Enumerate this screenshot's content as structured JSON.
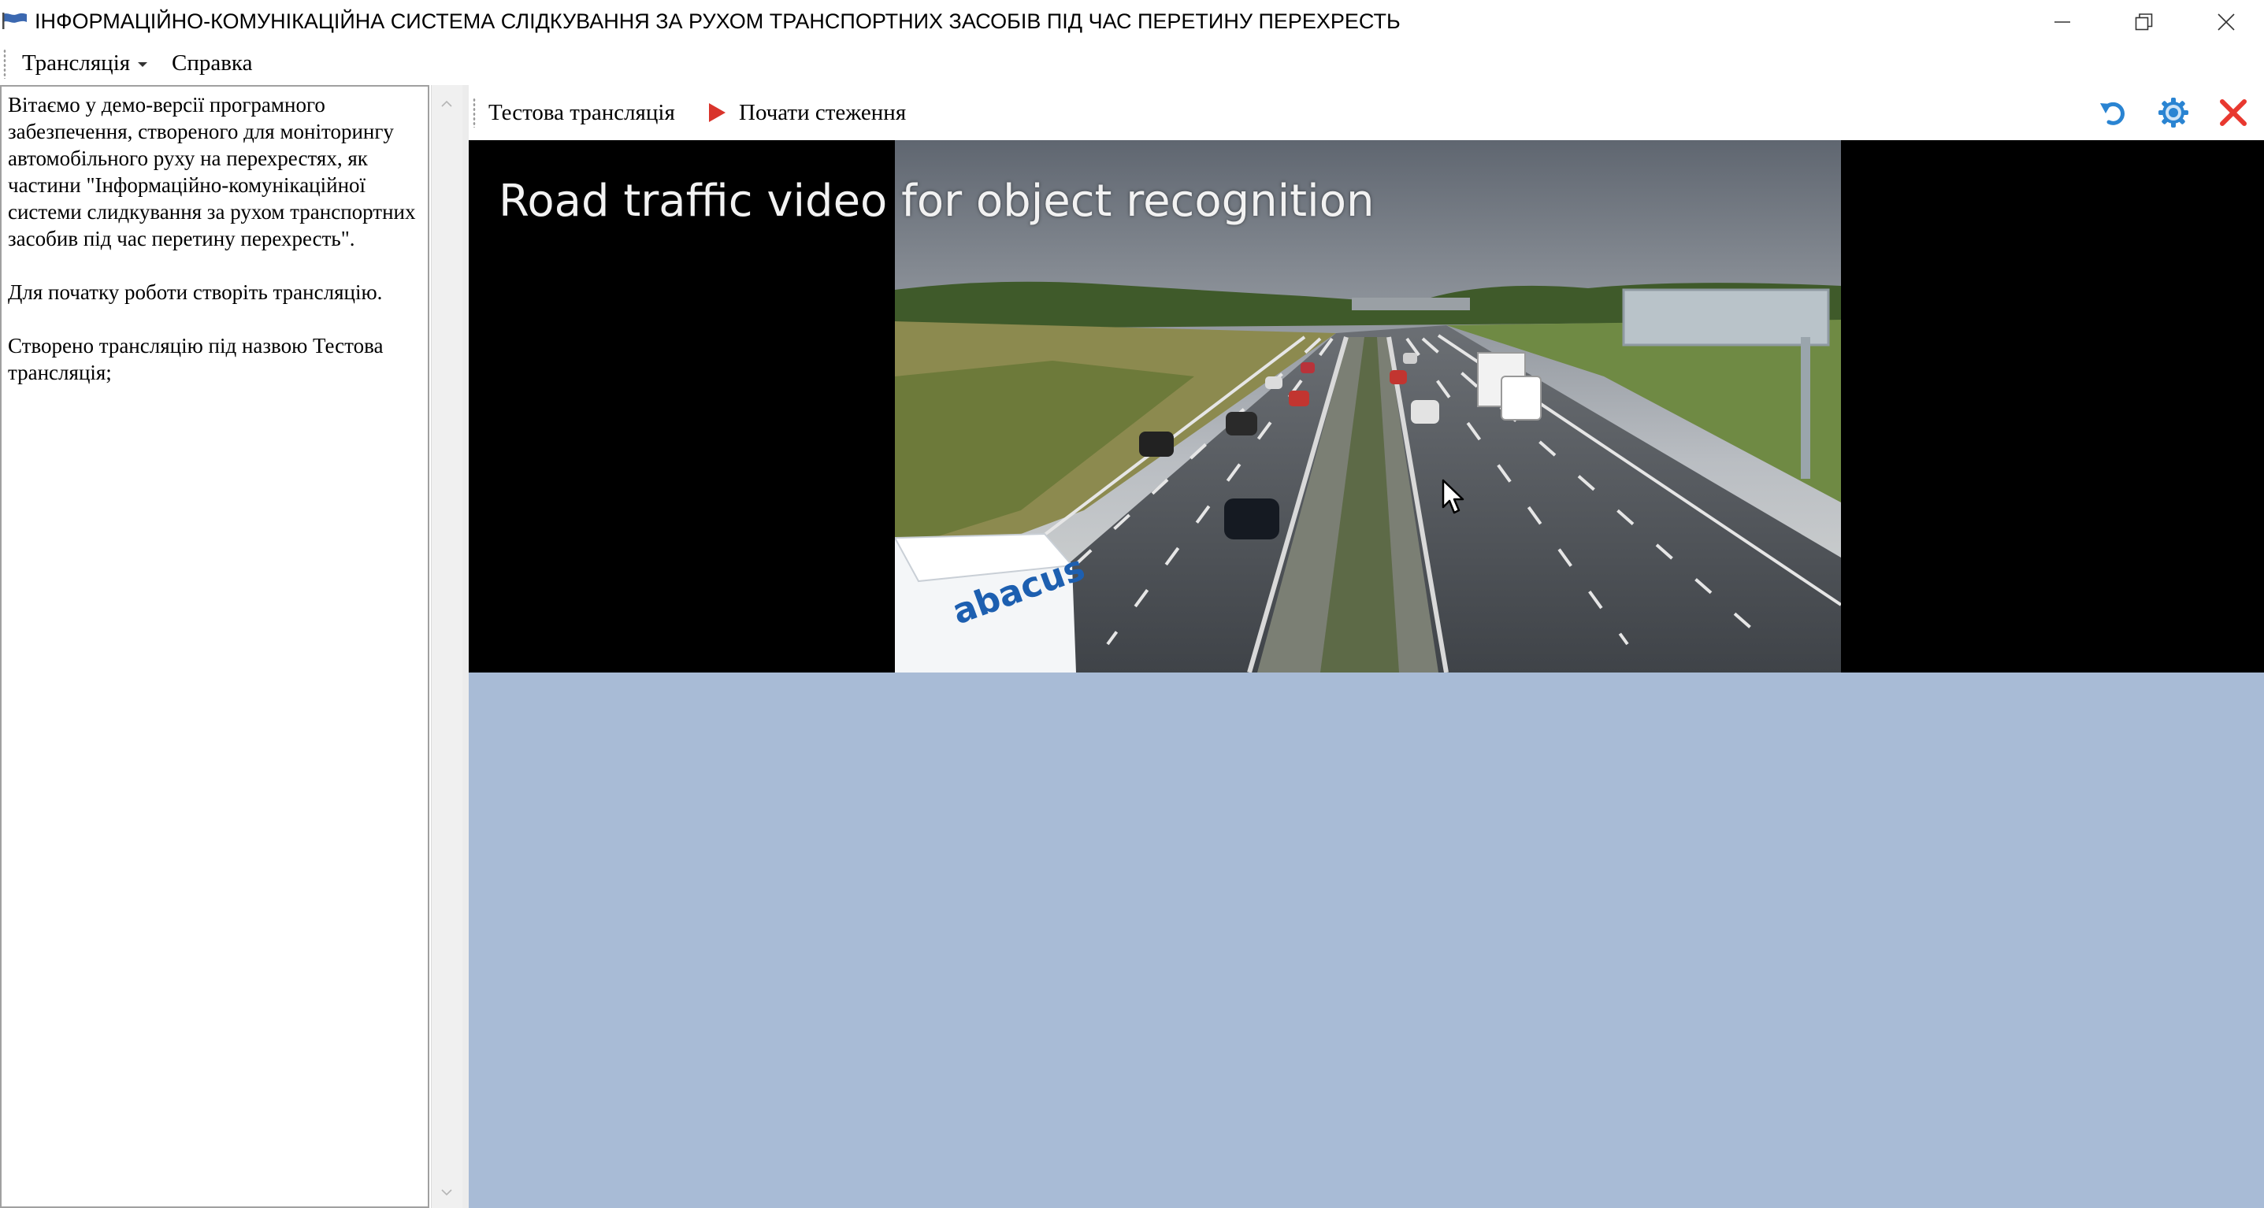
{
  "window": {
    "title": "ІНФОРМАЦІЙНО-КОМУНІКАЦІЙНА СИСТЕМА СЛІДКУВАННЯ ЗА РУХОМ ТРАНСПОРТНИХ ЗАСОБІВ ПІД ЧАС ПЕРЕТИНУ ПЕРЕХРЕСТЬ",
    "icon": "flag-icon",
    "controls": [
      "minimize-icon",
      "restore-icon",
      "close-icon"
    ]
  },
  "menu": {
    "items": [
      {
        "label": "Трансляція",
        "has_dropdown": true
      },
      {
        "label": "Справка",
        "has_dropdown": false
      }
    ]
  },
  "log": {
    "paragraphs": [
      "Вітаємо у демо-версії програмного забезпечення, створеного для моніторингу автомобільного руху на перехрестях, як частини \"Інформаційно-комунікаційної системи слидкування за рухом транспортних засобив під час перетину перехресть\".",
      "Для початку роботи створіть трансляцію.",
      "Створено трансляцію під назвою Тестова трансляція;"
    ]
  },
  "toolbar": {
    "stream_name": "Тестова трансляція",
    "start_label": "Почати стеження",
    "icons": [
      "refresh-icon",
      "settings-icon",
      "close-icon"
    ]
  },
  "video": {
    "overlay_title": "Road traffic video for object recognition",
    "truck_logo": "abacus"
  },
  "colors": {
    "content_background": "#a8bbd6",
    "play_accent": "#d9342b",
    "close_accent": "#e8382f",
    "icon_blue": "#2a84d2"
  }
}
